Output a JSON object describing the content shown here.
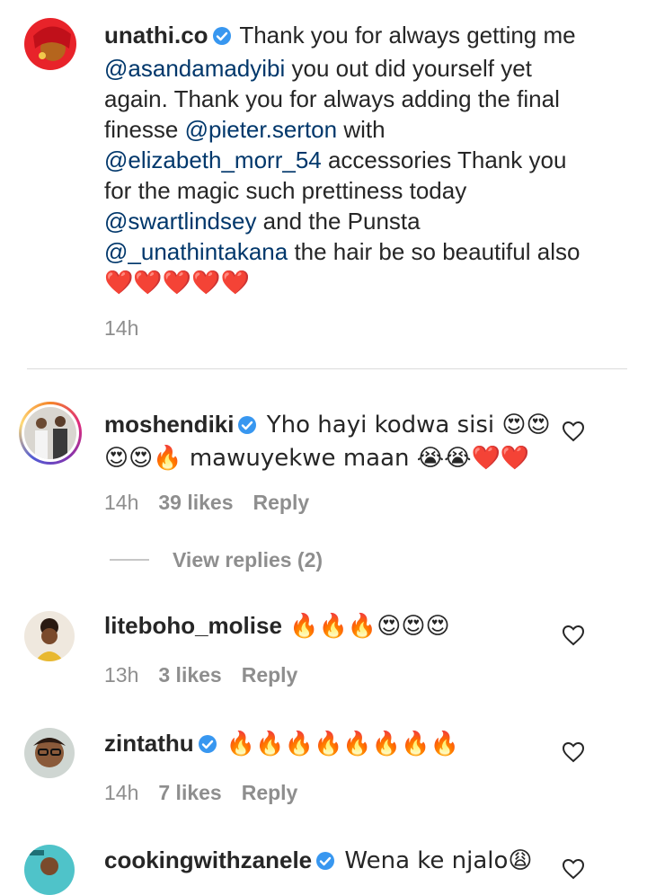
{
  "colors": {
    "mention": "#00376b",
    "meta": "#8e8e8e",
    "verified": "#3897f0",
    "heart": "#ed1c4c"
  },
  "caption": {
    "username": "unathi.co",
    "parts": [
      " Thank you for always getting me ",
      "@asandamadyibi",
      " you out did yourself yet again. Thank you for always adding the final finesse ",
      "@pieter.serton",
      " with ",
      "@elizabeth_morr_54",
      " accessories Thank you for the magic such prettiness today ",
      "@swartlindsey",
      " and the Punsta ",
      "@_unathintakana",
      " the hair be so beautiful also",
      "❤️❤️❤️❤️❤️"
    ],
    "time": "14h"
  },
  "comments": [
    {
      "username": "moshendiki",
      "verified": true,
      "text": " Yho hayi kodwa sisi 😍😍 😍😍🔥 mawuyekwe maan 😭😭❤️❤️",
      "time": "14h",
      "likes": "39 likes",
      "reply": "Reply",
      "view_replies": "View replies (2)"
    },
    {
      "username": "liteboho_molise",
      "verified": false,
      "text": " 🔥🔥🔥😍😍😍",
      "time": "13h",
      "likes": "3 likes",
      "reply": "Reply"
    },
    {
      "username": "zintathu",
      "verified": true,
      "text": " 🔥🔥🔥🔥🔥🔥🔥🔥",
      "time": "14h",
      "likes": "7 likes",
      "reply": "Reply"
    },
    {
      "username": "cookingwithzanele",
      "verified": true,
      "text": " Wena ke njalo😩"
    }
  ]
}
